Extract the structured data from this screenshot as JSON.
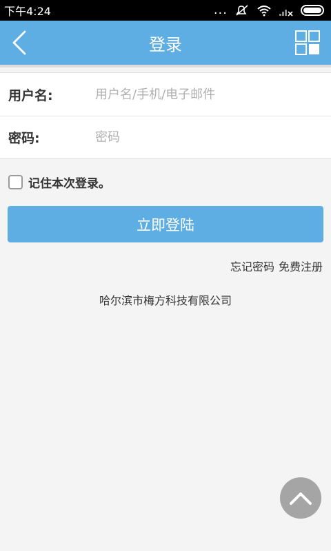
{
  "status_bar": {
    "time": "下午4:24",
    "dots": "..."
  },
  "header": {
    "title": "登录"
  },
  "form": {
    "username_label": "用户名:",
    "username_placeholder": "用户名/手机/电子邮件",
    "username_value": "",
    "password_label": "密码:",
    "password_placeholder": "密码",
    "password_value": ""
  },
  "remember": {
    "label": "记住本次登录。",
    "checked": false
  },
  "login_button": {
    "label": "立即登陆"
  },
  "links": {
    "forgot_password": "忘记密码",
    "register": "免费注册"
  },
  "footer": {
    "company": "哈尔滨市梅方科技有限公司"
  },
  "colors": {
    "accent": "#5eaee4",
    "status_bar": "#000000",
    "background": "#f4f4f4",
    "scroll_top": "#a5a5a5"
  },
  "icons": {
    "back": "back-arrow-icon",
    "menu": "grid-icon",
    "scroll_top": "chevron-up-icon"
  }
}
